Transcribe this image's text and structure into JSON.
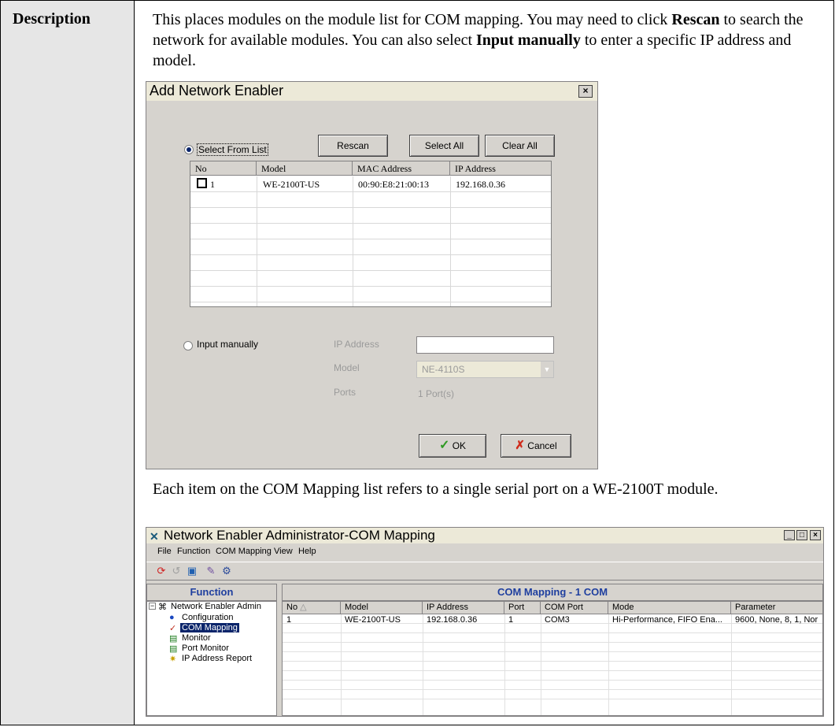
{
  "label": "Description",
  "description": {
    "part1": "This places modules on the module list for COM mapping. You may need to click ",
    "rescan_bold": "Rescan",
    "part2": " to search the network for available modules. You can also select ",
    "input_bold": "Input manually",
    "part3": " to enter a specific IP address and model."
  },
  "caption": "Each item on the COM Mapping list refers to a single serial port on a WE-2100T module.",
  "dialog": {
    "title": "Add Network Enabler",
    "close": "×",
    "select_from_list": "Select From List",
    "rescan": "Rescan",
    "select_all": "Select All",
    "clear_all": "Clear All",
    "columns": [
      "No",
      "Model",
      "MAC Address",
      "IP Address"
    ],
    "row": {
      "no": "1",
      "model": "WE-2100T-US",
      "mac": "00:90:E8:21:00:13",
      "ip": "192.168.0.36"
    },
    "input_manually": "Input manually",
    "ip_address_label": "IP Address",
    "ip_address_value": "",
    "model_label": "Model",
    "model_value": "NE-4110S",
    "ports_label": "Ports",
    "ports_value": "1 Port(s)",
    "ok": "OK",
    "cancel": "Cancel"
  },
  "app": {
    "title": "Network Enabler Administrator-COM Mapping",
    "min": "_",
    "max": "□",
    "close": "×",
    "menu": [
      "File",
      "Function",
      "COM Mapping",
      "View",
      "Help"
    ],
    "function_header": "Function",
    "mapping_header": "COM Mapping - 1 COM",
    "tree": {
      "root": "Network Enabler Admin",
      "items": [
        "Configuration",
        "COM Mapping",
        "Monitor",
        "Port Monitor",
        "IP Address Report"
      ]
    },
    "columns": [
      "No",
      "Model",
      "IP Address",
      "Port",
      "COM Port",
      "Mode",
      "Parameter"
    ],
    "row": {
      "no": "1",
      "model": "WE-2100T-US",
      "ip": "192.168.0.36",
      "port": "1",
      "com": "COM3",
      "mode": "Hi-Performance, FIFO Ena...",
      "parameter": "9600, None, 8, 1, Nor"
    }
  }
}
